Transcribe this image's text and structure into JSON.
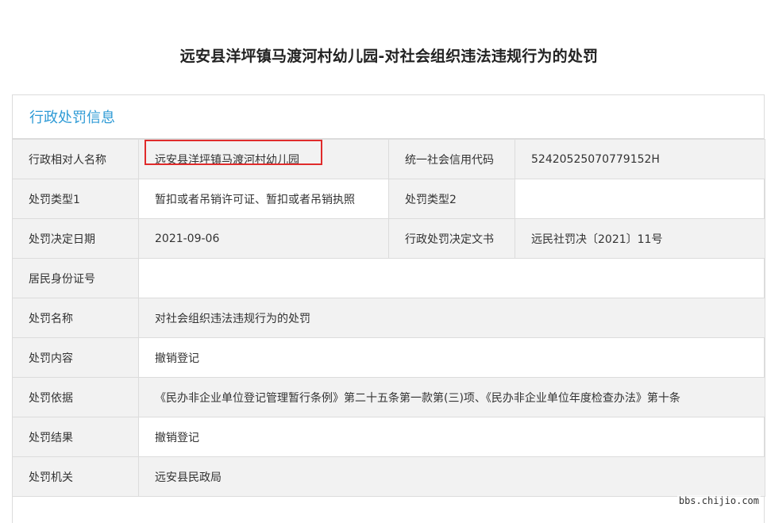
{
  "page_title": "远安县洋坪镇马渡河村幼儿园-对社会组织违法违规行为的处罚",
  "section_title": "行政处罚信息",
  "rows": {
    "r1": {
      "l1": "行政相对人名称",
      "v1": "远安县洋坪镇马渡河村幼儿园",
      "l2": "统一社会信用代码",
      "v2": "52420525070779152H"
    },
    "r2": {
      "l1": "处罚类型1",
      "v1": "暂扣或者吊销许可证、暂扣或者吊销执照",
      "l2": "处罚类型2",
      "v2": ""
    },
    "r3": {
      "l1": "处罚决定日期",
      "v1": "2021-09-06",
      "l2": "行政处罚决定文书",
      "v2": "远民社罚决〔2021〕11号"
    },
    "r4": {
      "l1": "居民身份证号",
      "v1": ""
    },
    "r5": {
      "l1": "处罚名称",
      "v1": "对社会组织违法违规行为的处罚"
    },
    "r6": {
      "l1": "处罚内容",
      "v1": "撤销登记"
    },
    "r7": {
      "l1": "处罚依据",
      "v1": "《民办非企业单位登记管理暂行条例》第二十五条第一款第(三)项、《民办非企业单位年度检查办法》第十条"
    },
    "r8": {
      "l1": "处罚结果",
      "v1": "撤销登记"
    },
    "r9": {
      "l1": "处罚机关",
      "v1": "远安县民政局"
    }
  },
  "watermark": "bbs.chijio.com",
  "colors": {
    "accent": "#2f9bd6",
    "highlight_border": "#e02b2b",
    "label_bg": "#f2f2f2",
    "border": "#dcdcdc"
  }
}
